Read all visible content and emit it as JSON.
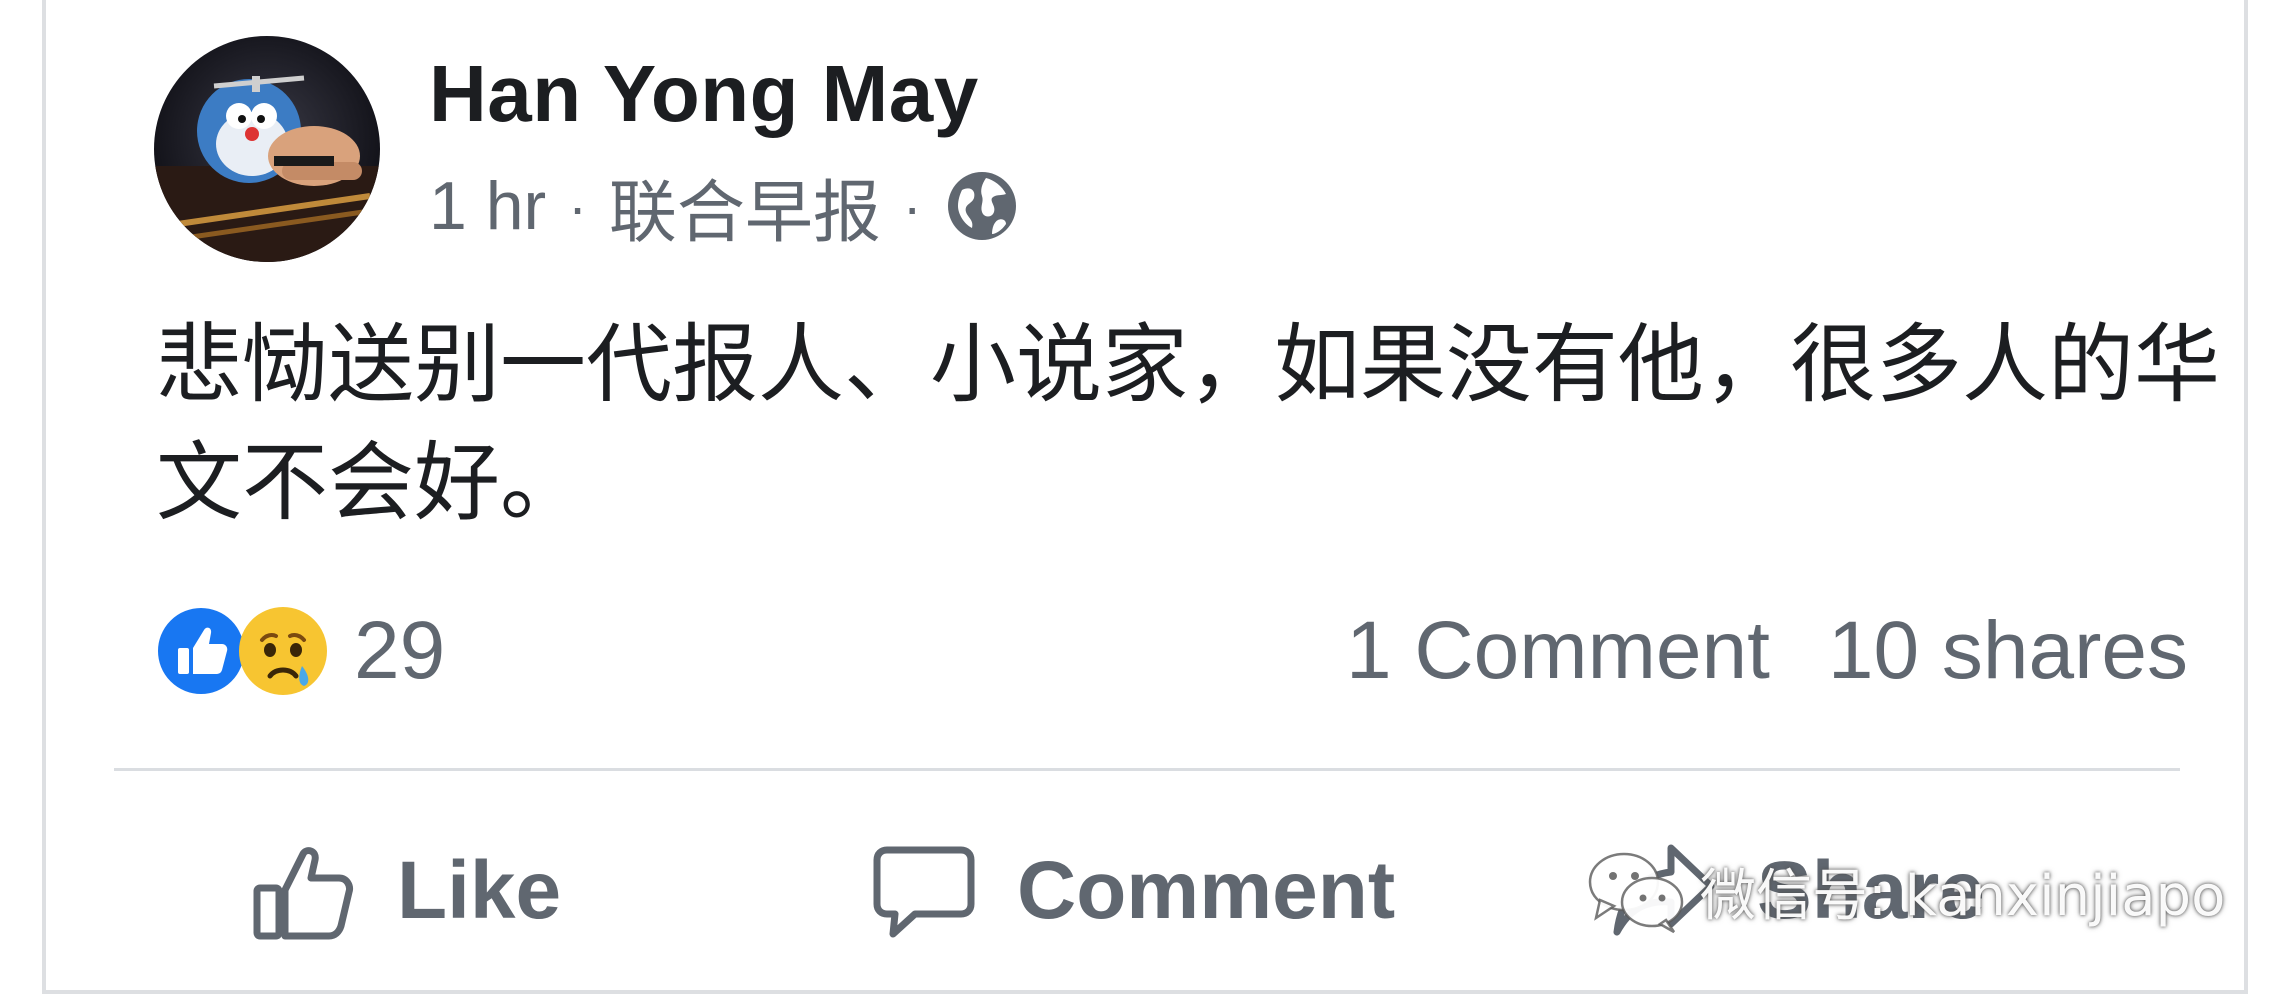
{
  "post": {
    "author": "Han Yong May",
    "time": "1 hr",
    "separator": "·",
    "source": "联合早报",
    "privacy_icon": "globe-icon",
    "text": "悲恸送别一代报人、小说家，如果没有他，很多人的华文不会好。"
  },
  "reactions": {
    "icons": [
      "like-reaction-icon",
      "sad-reaction-icon"
    ],
    "count": "29",
    "like_color": "#1877f2",
    "sad_color": "#f7c531"
  },
  "stats": {
    "comments": "1 Comment",
    "shares": "10 shares"
  },
  "actions": {
    "like": "Like",
    "comment": "Comment",
    "share": "Share"
  },
  "watermark": {
    "icon": "wechat-icon",
    "text": "微信号: kanxinjiapo"
  }
}
